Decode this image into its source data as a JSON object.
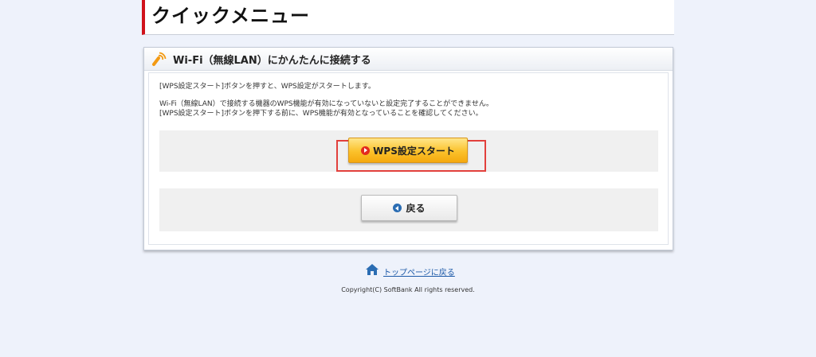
{
  "header": {
    "title": "クイックメニュー"
  },
  "panel": {
    "title": "Wi-Fi（無線LAN）にかんたんに接続する",
    "description_line1": "[WPS設定スタート]ボタンを押すと、WPS設定がスタートします。",
    "description_line2": "Wi-Fi（無線LAN）で接続する機器のWPS機能が有効になっていないと設定完了することができません。",
    "description_line3": "[WPS設定スタート]ボタンを押下する前に、WPS機能が有効となっていることを確認してください。",
    "wps_button_label": "WPS設定スタート",
    "back_button_label": "戻る"
  },
  "footer": {
    "top_link_label": "トップページに戻る",
    "copyright": "Copyright(C) SoftBank All rights reserved."
  },
  "colors": {
    "accent_red": "#d0121b",
    "wps_button": "#fbc22b",
    "link_blue": "#1d5aa8",
    "highlight_box": "#e2403c"
  },
  "icons": {
    "panel_icon": "wifi-antenna-icon",
    "wps_button_icon": "play-icon",
    "back_button_icon": "back-arrow-icon",
    "top_link_icon": "home-icon"
  }
}
